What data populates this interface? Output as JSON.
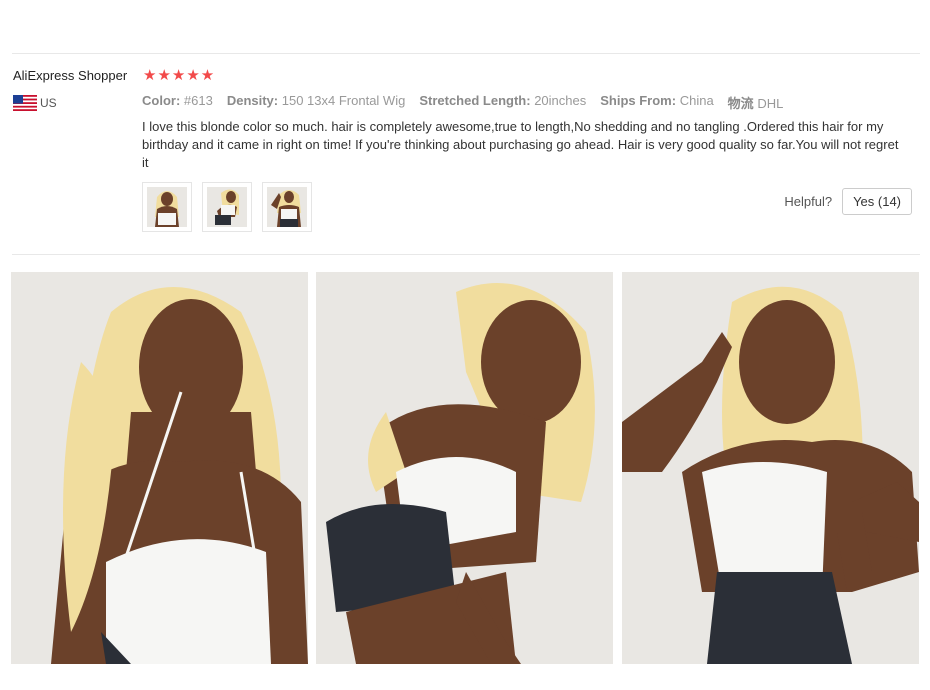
{
  "review": {
    "user_name": "AliExpress Shopper",
    "rating": 5,
    "stars": "★★★★★",
    "country": {
      "flag": "us-flag-icon",
      "code": "US"
    },
    "properties": [
      {
        "key": "Color:",
        "value": "#613"
      },
      {
        "key": "Density:",
        "value": "150 13x4 Frontal Wig"
      },
      {
        "key": "Stretched Length:",
        "value": "20inches"
      },
      {
        "key": "Ships From:",
        "value": "China"
      },
      {
        "key": "物流",
        "value": "DHL"
      }
    ],
    "text": "I love this blonde color so much. hair is completely awesome,true to length,No shedding and no tangling .Ordered this hair for my birthday and it came in right on time! If you're thinking about purchasing go ahead. Hair is very good quality so far.You will not regret it",
    "helpful_label": "Helpful?",
    "yes_label": "Yes (14)",
    "helpful_count": 14,
    "thumbnail_count": 3
  },
  "colors": {
    "star": "#f24a4a",
    "hair": "#f1dd9e",
    "skin": "#6b412a",
    "top": "#f6f6f4",
    "denim": "#2b2f37",
    "wall": "#e9e7e3"
  }
}
